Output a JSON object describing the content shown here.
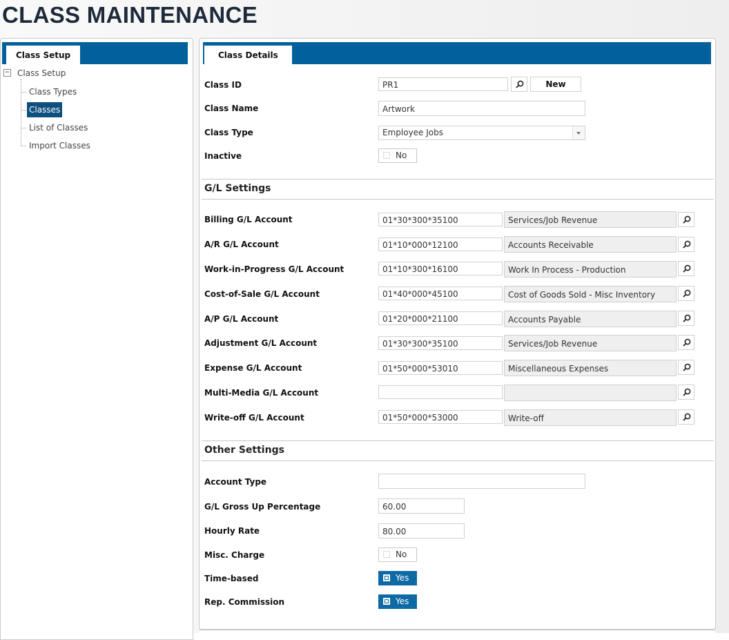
{
  "page_title": "CLASS MAINTENANCE",
  "left_panel": {
    "tab_label": "Class Setup",
    "tree": {
      "root_label": "Class Setup",
      "toggle_symbol": "−",
      "items": [
        {
          "label": "Class Types",
          "selected": false
        },
        {
          "label": "Classes",
          "selected": true
        },
        {
          "label": "List of Classes",
          "selected": false
        },
        {
          "label": "Import Classes",
          "selected": false
        }
      ]
    }
  },
  "right_panel": {
    "tab_label": "Class Details",
    "class_id": {
      "label": "Class ID",
      "value": "PR1",
      "new_button": "New"
    },
    "class_name": {
      "label": "Class Name",
      "value": "Artwork"
    },
    "class_type": {
      "label": "Class Type",
      "value": "Employee Jobs"
    },
    "inactive": {
      "label": "Inactive",
      "value": "No",
      "checked": false
    },
    "gl_settings": {
      "heading": "G/L Settings",
      "rows": [
        {
          "label": "Billing G/L Account",
          "account": "01*30*300*35100",
          "description": "Services/Job Revenue"
        },
        {
          "label": "A/R G/L Account",
          "account": "01*10*000*12100",
          "description": "Accounts Receivable"
        },
        {
          "label": "Work-in-Progress G/L Account",
          "account": "01*10*300*16100",
          "description": "Work In Process - Production"
        },
        {
          "label": "Cost-of-Sale G/L Account",
          "account": "01*40*000*45100",
          "description": "Cost of Goods Sold - Misc Inventory"
        },
        {
          "label": "A/P G/L Account",
          "account": "01*20*000*21100",
          "description": "Accounts Payable"
        },
        {
          "label": "Adjustment G/L Account",
          "account": "01*30*300*35100",
          "description": "Services/Job Revenue"
        },
        {
          "label": "Expense G/L Account",
          "account": "01*50*000*53010",
          "description": "Miscellaneous Expenses"
        },
        {
          "label": "Multi-Media G/L Account",
          "account": "",
          "description": ""
        },
        {
          "label": "Write-off G/L Account",
          "account": "01*50*000*53000",
          "description": "Write-off"
        }
      ]
    },
    "other_settings": {
      "heading": "Other Settings",
      "account_type": {
        "label": "Account Type",
        "value": ""
      },
      "gross_up": {
        "label": "G/L Gross Up Percentage",
        "value": "60.00"
      },
      "hourly_rate": {
        "label": "Hourly Rate",
        "value": "80.00"
      },
      "misc_charge": {
        "label": "Misc. Charge",
        "value": "No",
        "checked": false
      },
      "time_based": {
        "label": "Time-based",
        "value": "Yes",
        "checked": true
      },
      "rep_commission": {
        "label": "Rep. Commission",
        "value": "Yes",
        "checked": true
      }
    }
  },
  "colors": {
    "tab_bar": "#02619c",
    "selected_item": "#0d4f7e",
    "toggle_on": "#0d6aa5"
  },
  "icons": {
    "lookup": "magnifier-icon",
    "tree_toggle": "minus-box-icon",
    "dropdown": "chevron-down-icon"
  }
}
